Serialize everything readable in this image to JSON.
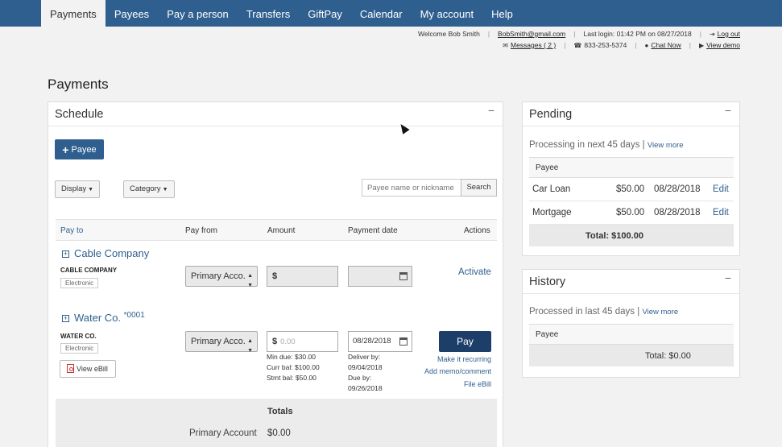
{
  "nav": {
    "items": [
      "Payments",
      "Payees",
      "Pay a person",
      "Transfers",
      "GiftPay",
      "Calendar",
      "My account",
      "Help"
    ],
    "active": "Payments"
  },
  "util": {
    "welcome": "Welcome Bob Smith",
    "email": "BobSmith@gmail.com",
    "last_login": "Last login: 01:42 PM on 08/27/2018",
    "logout": "Log out",
    "messages": "Messages ( 2 )",
    "phone": "833-253-5374",
    "chat": "Chat Now",
    "view_demo": "View demo"
  },
  "page_title": "Payments",
  "schedule": {
    "title": "Schedule",
    "collapse": "−",
    "payee_button": "Payee",
    "display": "Display",
    "category": "Category",
    "search_placeholder": "Payee name or nickname",
    "search_button": "Search",
    "columns": {
      "pay_to": "Pay to",
      "pay_from": "Pay from",
      "amount": "Amount",
      "payment_date": "Payment date",
      "actions": "Actions"
    },
    "payees": [
      {
        "name": "Cable Company",
        "caps": "CABLE COMPANY",
        "type": "Electronic",
        "account": "Primary Acco.",
        "currency": "$",
        "action": "Activate"
      },
      {
        "name": "Water Co.",
        "acct_num": "*0001",
        "caps": "WATER CO.",
        "type": "Electronic",
        "account": "Primary Acco.",
        "currency": "$",
        "amount_placeholder": "0.00",
        "date": "08/28/2018",
        "min_due": "Min due: $30.00",
        "curr_bal": "Curr bal: $100.00",
        "stmt_bal": "Stmt bal: $50.00",
        "deliver_by_label": "Deliver by:",
        "deliver_by": "09/04/2018",
        "due_by_label": "Due by:",
        "due_by": "09/26/2018",
        "view_ebill": "View eBill",
        "pay_button": "Pay",
        "make_recurring": "Make it recurring",
        "add_memo": "Add memo/comment",
        "file_ebill": "File eBill"
      }
    ],
    "totals": {
      "title": "Totals",
      "label": "Primary Account",
      "value": "$0.00"
    }
  },
  "pending": {
    "title": "Pending",
    "collapse": "−",
    "subtitle": "Processing in next 45 days",
    "sep": "|",
    "view_more": "View more",
    "column": "Payee",
    "rows": [
      {
        "payee": "Car Loan",
        "amount": "$50.00",
        "date": "08/28/2018",
        "action": "Edit"
      },
      {
        "payee": "Mortgage",
        "amount": "$50.00",
        "date": "08/28/2018",
        "action": "Edit"
      }
    ],
    "total": "Total: $100.00"
  },
  "history": {
    "title": "History",
    "collapse": "−",
    "subtitle": "Processed in last 45 days",
    "sep": "|",
    "view_more": "View more",
    "column": "Payee",
    "total": "Total: $0.00"
  }
}
